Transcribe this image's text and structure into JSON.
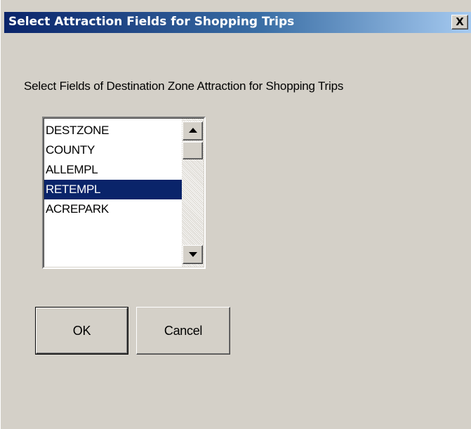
{
  "window": {
    "title": "Select Attraction Fields for Shopping Trips",
    "close_glyph": "X",
    "colors": {
      "title_bar_start": "#0a246a",
      "title_bar_end": "#a6caf0",
      "dialog_background": "#d4d0c8",
      "selection": "#0a246a"
    }
  },
  "prompt": "Select Fields of Destination Zone Attraction for Shopping Trips",
  "field_list": {
    "items": [
      "DESTZONE",
      "COUNTY",
      "ALLEMPL",
      "RETEMPL",
      "ACREPARK"
    ],
    "selected_index": 3,
    "scrollbar": {
      "up_icon": "arrow-up-icon",
      "down_icon": "arrow-down-icon"
    }
  },
  "buttons": {
    "ok_label": "OK",
    "cancel_label": "Cancel"
  }
}
